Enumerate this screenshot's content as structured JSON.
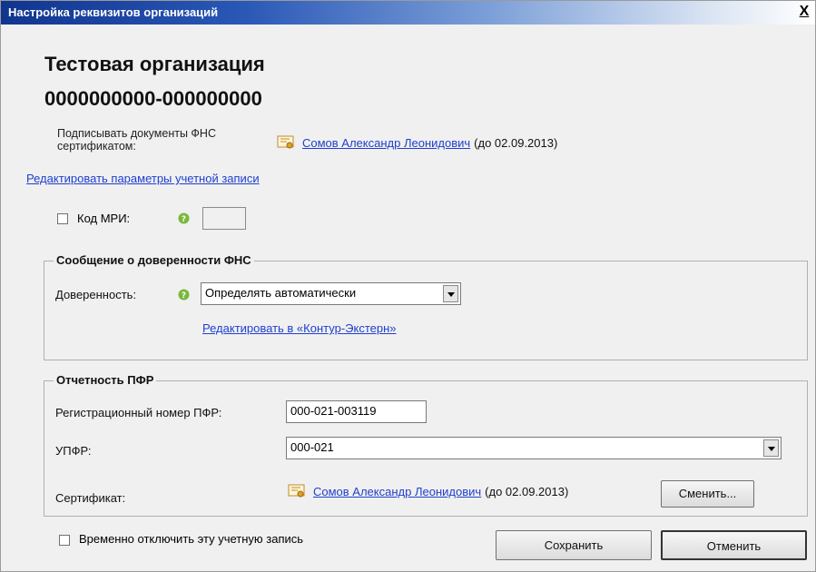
{
  "window": {
    "title": "Настройка реквизитов организаций",
    "close_label": "X"
  },
  "org": {
    "name": "Тестовая организация",
    "code": "0000000000-000000000"
  },
  "signing": {
    "label": "Подписывать документы ФНС сертификатом:",
    "cert_owner": "Сомов Александр Леонидович",
    "cert_validity": "(до 02.09.2013)"
  },
  "edit_account_link": "Редактировать параметры учетной записи",
  "mri": {
    "label": "Код МРИ:",
    "value": ""
  },
  "fns_group": {
    "title": "Сообщение о доверенности ФНС",
    "dov_label": "Доверенность:",
    "dov_selected": "Определять автоматически",
    "kontur_link": "Редактировать в «Контур-Экстерн»"
  },
  "pfr_group": {
    "title": "Отчетность ПФР",
    "reg_label": "Регистрационный номер ПФР:",
    "reg_value": "000-021-003119",
    "upfr_label": "УПФР:",
    "upfr_selected": "000-021",
    "cert_label": "Сертификат:",
    "cert_owner": "Сомов Александр Леонидович",
    "cert_validity": "(до 02.09.2013)",
    "change_button": "Сменить..."
  },
  "footer": {
    "disable_label": "Временно отключить эту учетную запись",
    "save_button": "Сохранить",
    "cancel_button": "Отменить"
  },
  "colors": {
    "link": "#1f3fcf",
    "title_bar": "#10358f",
    "help_icon": "#7ab83a"
  }
}
